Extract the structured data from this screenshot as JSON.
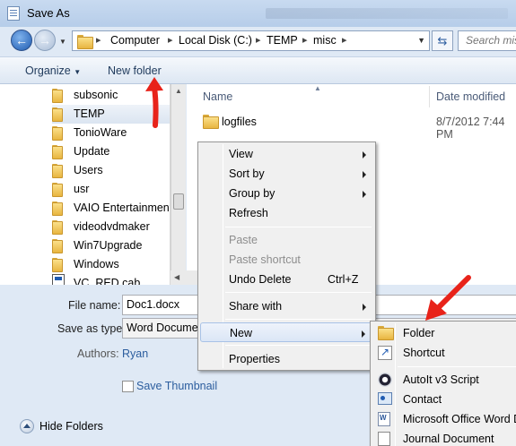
{
  "window": {
    "title": "Save As"
  },
  "address": {
    "crumbs": [
      "Computer",
      "Local Disk (C:)",
      "TEMP",
      "misc"
    ],
    "search_placeholder": "Search misc"
  },
  "toolbar": {
    "organize_label": "Organize",
    "new_folder_label": "New folder"
  },
  "nav": {
    "items": [
      {
        "label": "subsonic",
        "selected": false
      },
      {
        "label": "TEMP",
        "selected": true
      },
      {
        "label": "TonioWare",
        "selected": false
      },
      {
        "label": "Update",
        "selected": false
      },
      {
        "label": "Users",
        "selected": false
      },
      {
        "label": "usr",
        "selected": false
      },
      {
        "label": "VAIO Entertainment",
        "selected": false
      },
      {
        "label": "videodvdmaker",
        "selected": false
      },
      {
        "label": "Win7Upgrade",
        "selected": false
      },
      {
        "label": "Windows",
        "selected": false
      },
      {
        "label": "VC_RED.cab",
        "selected": false
      }
    ]
  },
  "files": {
    "columns": {
      "name": "Name",
      "date": "Date modified"
    },
    "rows": [
      {
        "name": "logfiles",
        "date": "8/7/2012 7:44 PM"
      }
    ]
  },
  "form": {
    "filename_label": "File name:",
    "filename_value": "Doc1.docx",
    "savetype_label": "Save as type:",
    "savetype_value": "Word Document",
    "authors_label": "Authors:",
    "authors_value": "Ryan",
    "thumbnail_label": "Save Thumbnail",
    "hide_folders_label": "Hide Folders"
  },
  "context_menu": {
    "items": [
      {
        "label": "View",
        "submenu": true
      },
      {
        "label": "Sort by",
        "submenu": true
      },
      {
        "label": "Group by",
        "submenu": true
      },
      {
        "label": "Refresh"
      },
      {
        "label": "Paste",
        "disabled": true
      },
      {
        "label": "Paste shortcut",
        "disabled": true
      },
      {
        "label": "Undo Delete",
        "shortcut": "Ctrl+Z"
      },
      {
        "label": "Share with",
        "submenu": true
      },
      {
        "label": "New",
        "submenu": true,
        "highlighted": true
      },
      {
        "label": "Properties"
      }
    ]
  },
  "new_submenu": {
    "items": [
      {
        "label": "Folder",
        "icon": "folder-icon"
      },
      {
        "label": "Shortcut",
        "icon": "shortcut-icon"
      },
      {
        "label": "AutoIt v3 Script",
        "icon": "autoit-icon"
      },
      {
        "label": "Contact",
        "icon": "contact-icon"
      },
      {
        "label": "Microsoft Office Word Document",
        "icon": "word-document-icon"
      },
      {
        "label": "Journal Document",
        "icon": "journal-icon"
      }
    ]
  },
  "annotation_color": "#e8231a"
}
